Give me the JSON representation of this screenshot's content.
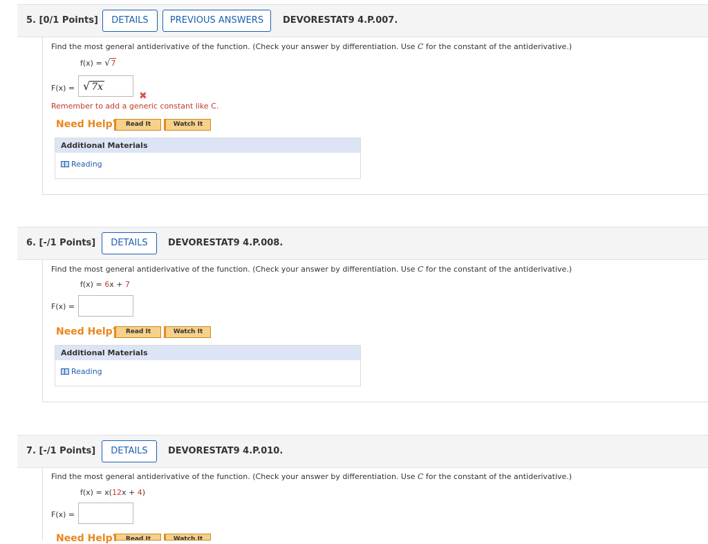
{
  "questions": [
    {
      "number": "5. [0/1 Points]",
      "details_label": "DETAILS",
      "previous_answers_label": "PREVIOUS ANSWERS",
      "code": "DEVORESTAT9 4.P.007.",
      "prompt_pre": "Find the most general antiderivative of the function. (Check your answer by differentiation. Use ",
      "prompt_c": "C",
      "prompt_post": " for the constant of the antiderivative.)",
      "fx_label": "f(x) = ",
      "fx_radicand": "7",
      "F_label": "F(x) = ",
      "answer_radicand": "7x",
      "feedback": "Remember to add a generic constant like C.",
      "need_help": "Need Help?",
      "read_it": "Read It",
      "watch_it": "Watch It",
      "materials_title": "Additional Materials",
      "reading": "Reading"
    },
    {
      "number": "6. [-/1 Points]",
      "details_label": "DETAILS",
      "code": "DEVORESTAT9 4.P.008.",
      "prompt_pre": "Find the most general antiderivative of the function. (Check your answer by differentiation. Use ",
      "prompt_c": "C",
      "prompt_post": " for the constant of the antiderivative.)",
      "fx_label": "f(x) = ",
      "fx_a": "6",
      "fx_b": "x + ",
      "fx_c": "7",
      "F_label": "F(x) = ",
      "need_help": "Need Help?",
      "read_it": "Read It",
      "watch_it": "Watch It",
      "materials_title": "Additional Materials",
      "reading": "Reading"
    },
    {
      "number": "7. [-/1 Points]",
      "details_label": "DETAILS",
      "code": "DEVORESTAT9 4.P.010.",
      "prompt_pre": "Find the most general antiderivative of the function. (Check your answer by differentiation. Use ",
      "prompt_c": "C",
      "prompt_post": " for the constant of the antiderivative.)",
      "fx_label": "f(x) = x(",
      "fx_a": "12",
      "fx_b": "x + ",
      "fx_c": "4",
      "fx_end": ")",
      "F_label": "F(x) = ",
      "need_help": "Need Help?",
      "read_it": "Read It",
      "watch_it": "Watch It"
    }
  ],
  "icons": {
    "incorrect": "x-mark-icon",
    "reading": "book-icon"
  },
  "colors": {
    "accent_blue": "#1b5fb0",
    "error_red": "#c0392b",
    "help_orange": "#e8871e"
  }
}
